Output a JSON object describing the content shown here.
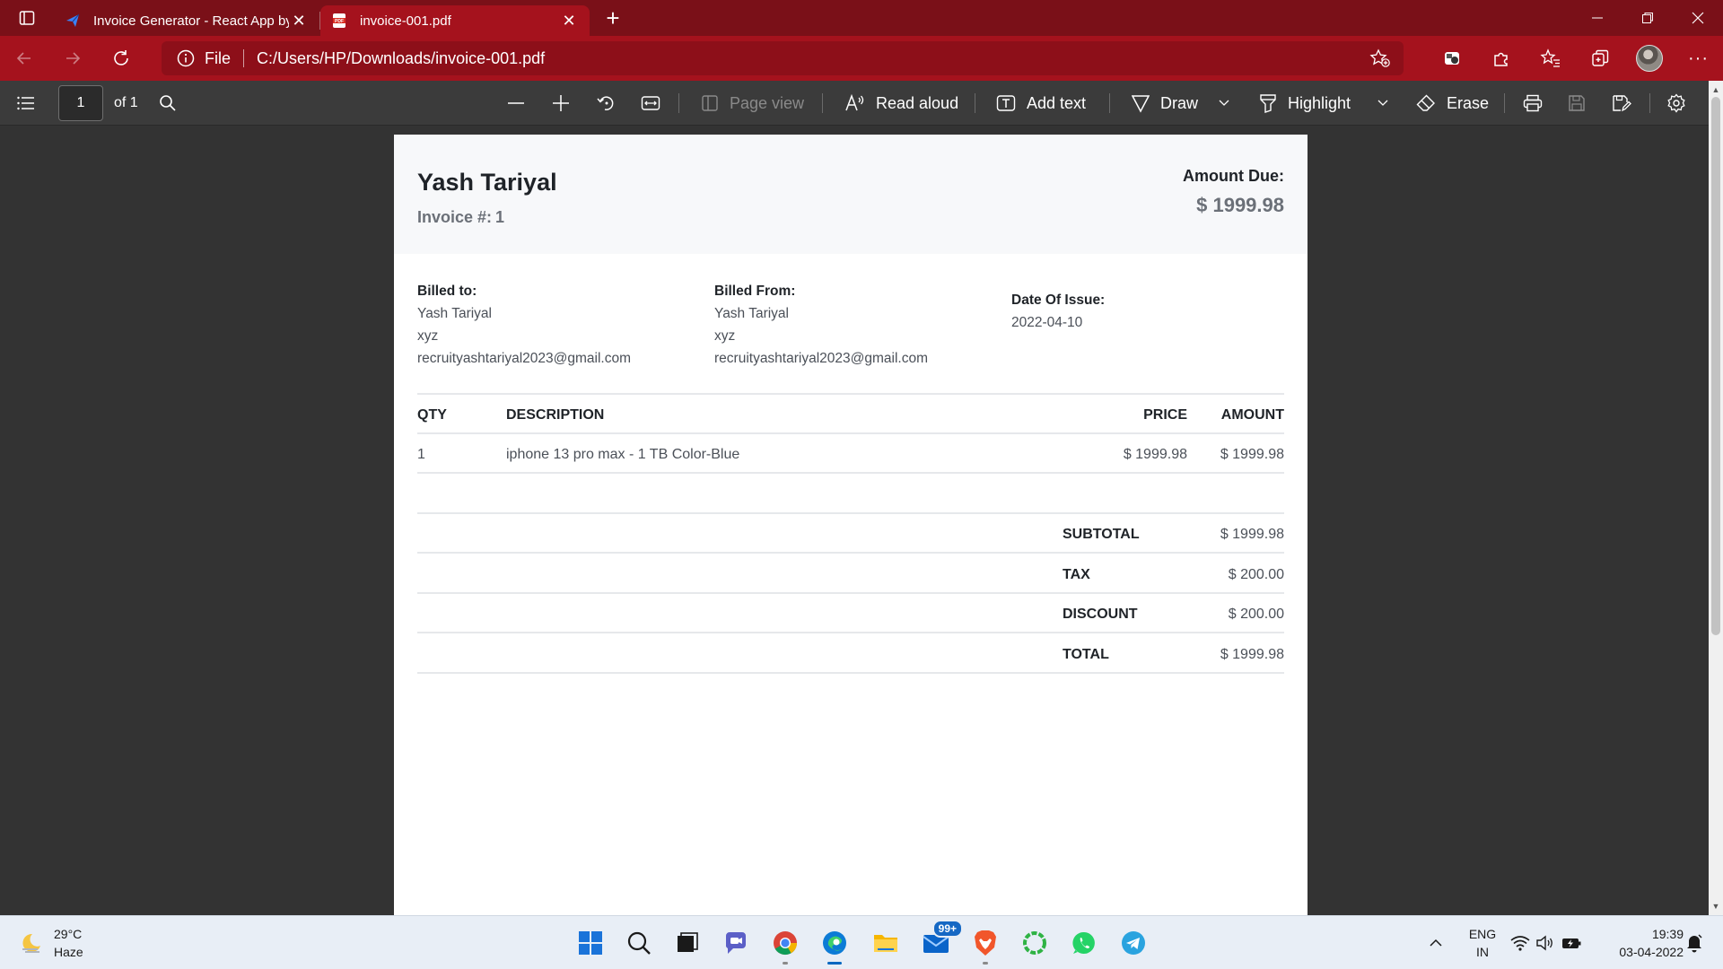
{
  "browser": {
    "tabs": [
      {
        "title": "Invoice Generator - React App by",
        "icon": "telegram-like-app-icon",
        "active": false
      },
      {
        "title": "invoice-001.pdf",
        "icon": "pdf-icon",
        "active": true
      }
    ],
    "address": {
      "scheme_label": "File",
      "url": "C:/Users/HP/Downloads/invoice-001.pdf"
    },
    "accent_color": "#a5121d"
  },
  "pdf_toolbar": {
    "page_number": "1",
    "page_count": "of 1",
    "page_view_label": "Page view",
    "read_aloud_label": "Read aloud",
    "add_text_label": "Add text",
    "draw_label": "Draw",
    "highlight_label": "Highlight",
    "erase_label": "Erase"
  },
  "invoice": {
    "name": "Yash Tariyal",
    "invoice_label": "Invoice #:",
    "invoice_number": "1",
    "amount_due_label": "Amount Due:",
    "amount_due": "$ 1999.98",
    "billed_to": {
      "title": "Billed to:",
      "name": "Yash Tariyal",
      "address": "xyz",
      "email": "recruityashtariyal2023@gmail.com"
    },
    "billed_from": {
      "title": "Billed From:",
      "name": "Yash Tariyal",
      "address": "xyz",
      "email": "recruityashtariyal2023@gmail.com"
    },
    "date_issue": {
      "title": "Date Of Issue:",
      "value": "2022-04-10"
    },
    "columns": {
      "qty": "QTY",
      "description": "DESCRIPTION",
      "price": "PRICE",
      "amount": "AMOUNT"
    },
    "items": [
      {
        "qty": "1",
        "description": "iphone 13 pro max - 1 TB Color-Blue",
        "price": "$ 1999.98",
        "amount": "$ 1999.98"
      }
    ],
    "totals": {
      "subtotal_label": "SUBTOTAL",
      "subtotal": "$ 1999.98",
      "tax_label": "TAX",
      "tax": "$ 200.00",
      "discount_label": "DISCOUNT",
      "discount": "$ 200.00",
      "total_label": "TOTAL",
      "total": "$ 1999.98"
    }
  },
  "taskbar": {
    "weather": {
      "temp": "29°C",
      "condition": "Haze"
    },
    "mail_badge": "99+",
    "language": {
      "line1": "ENG",
      "line2": "IN"
    },
    "clock": {
      "time": "19:39",
      "date": "03-04-2022"
    }
  }
}
